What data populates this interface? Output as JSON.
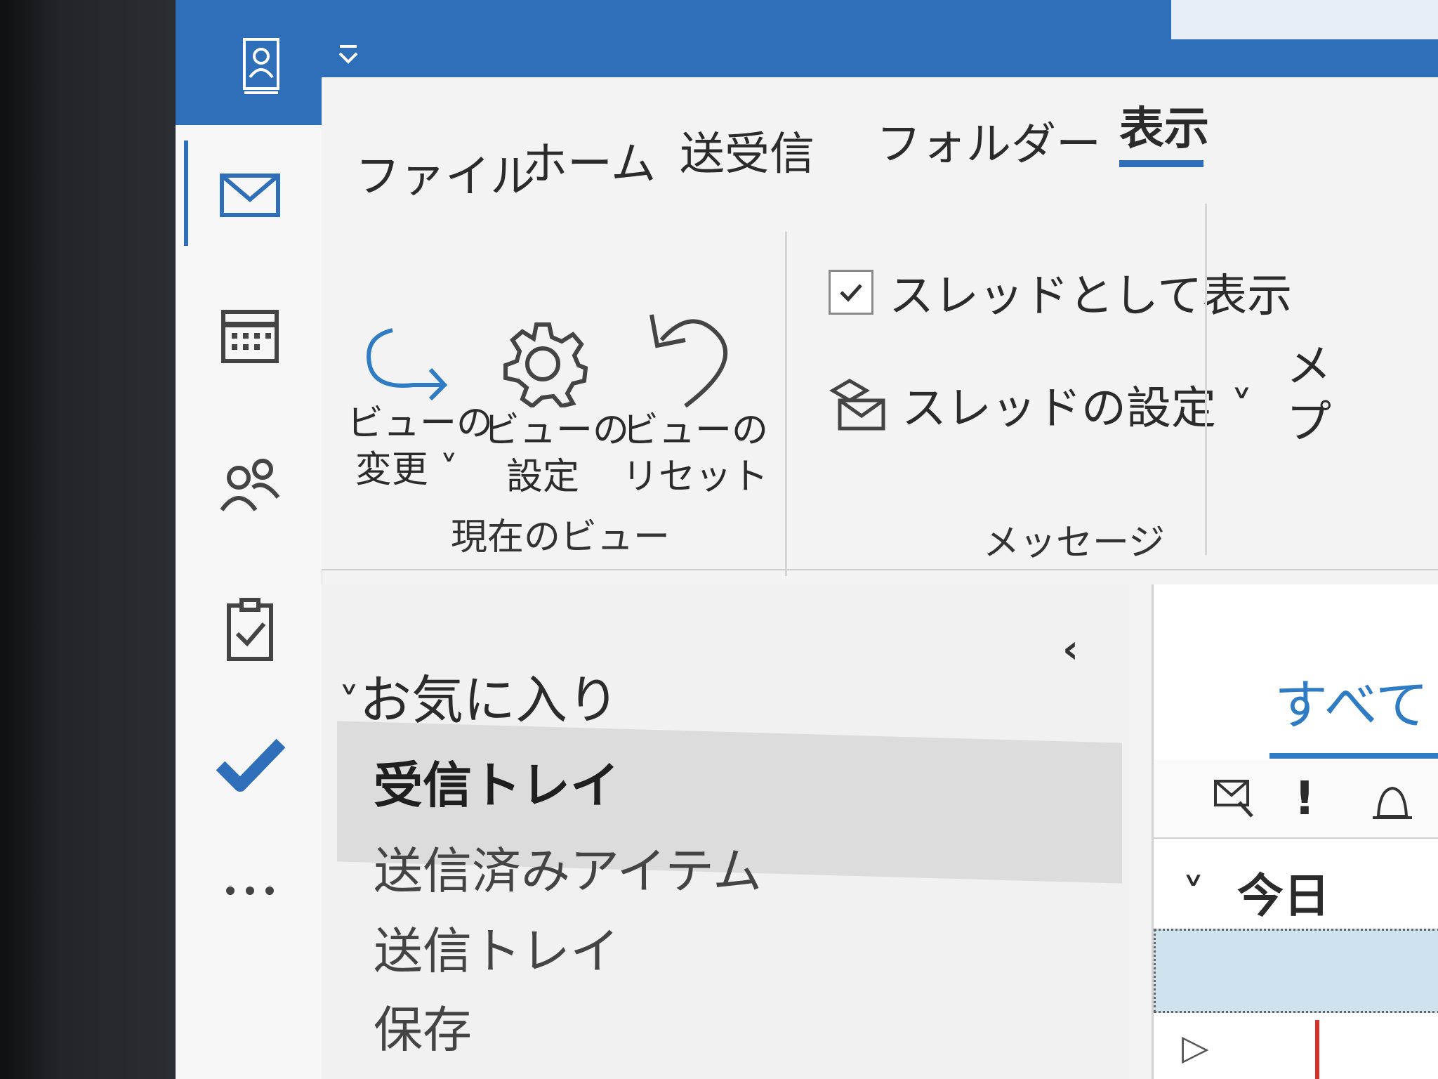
{
  "titlebar": {
    "accent": "#2f6fb9"
  },
  "ribbon": {
    "tabs": [
      {
        "label": "ファイル"
      },
      {
        "label": "ホーム"
      },
      {
        "label": "送受信"
      },
      {
        "label": "フォルダー"
      },
      {
        "label": "表示"
      }
    ],
    "current_view": {
      "group_label": "現在のビュー",
      "change_view": {
        "line1": "ビューの",
        "line2": "変更 ˅"
      },
      "view_settings": {
        "line1": "ビューの",
        "line2": "設定"
      },
      "reset_view": {
        "line1": "ビューの",
        "line2": "リセット"
      }
    },
    "messages": {
      "group_label": "メッセージ",
      "show_as_conversations": "スレッドとして表示",
      "show_as_conversations_checked": true,
      "conversation_settings": "スレッドの設定 ˅"
    },
    "next_group_partial": {
      "line1": "メ",
      "line2": "プ"
    }
  },
  "folders": {
    "favorites_header": "お気に入り",
    "items": [
      {
        "label": "受信トレイ",
        "selected": true
      },
      {
        "label": "送信済みアイテム",
        "selected": false
      },
      {
        "label": "送信トレイ",
        "selected": false
      },
      {
        "label": "保存",
        "selected": false
      }
    ]
  },
  "message_list": {
    "filter_all": "すべて",
    "group_today": "今日",
    "accent": "#2f7cc4"
  },
  "icons": {
    "nav": [
      "mail-icon",
      "calendar-icon",
      "people-icon",
      "tasks-icon",
      "todo-check-icon",
      "more-icon"
    ]
  }
}
